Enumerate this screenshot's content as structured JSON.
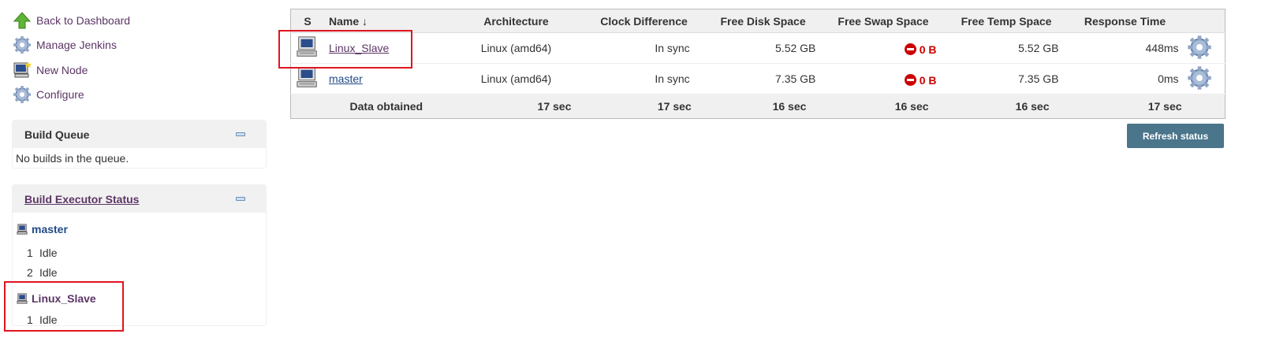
{
  "sidebar": {
    "tasks": [
      {
        "label": "Back to Dashboard",
        "icon": "up-arrow-icon"
      },
      {
        "label": "Manage Jenkins",
        "icon": "gear-icon"
      },
      {
        "label": "New Node",
        "icon": "new-computer-icon"
      },
      {
        "label": "Configure",
        "icon": "gear-icon"
      }
    ],
    "build_queue": {
      "title": "Build Queue",
      "empty_text": "No builds in the queue."
    },
    "executor_status": {
      "title": "Build Executor Status",
      "computers": [
        {
          "name": "master",
          "executors": [
            {
              "num": "1",
              "status": "Idle"
            },
            {
              "num": "2",
              "status": "Idle"
            }
          ]
        },
        {
          "name": "Linux_Slave",
          "executors": [
            {
              "num": "1",
              "status": "Idle"
            }
          ]
        }
      ]
    }
  },
  "table": {
    "headers": {
      "s": "S",
      "name": "Name ↓",
      "architecture": "Architecture",
      "clock": "Clock Difference",
      "disk": "Free Disk Space",
      "swap": "Free Swap Space",
      "temp": "Free Temp Space",
      "response": "Response Time"
    },
    "rows": [
      {
        "name": "Linux_Slave",
        "architecture": "Linux (amd64)",
        "clock": "In sync",
        "disk": "5.52 GB",
        "swap": "0 B",
        "temp": "5.52 GB",
        "response": "448ms"
      },
      {
        "name": "master",
        "architecture": "Linux (amd64)",
        "clock": "In sync",
        "disk": "7.35 GB",
        "swap": "0 B",
        "temp": "7.35 GB",
        "response": "0ms"
      }
    ],
    "footer": {
      "label": "Data obtained",
      "architecture": "17 sec",
      "clock": "17 sec",
      "disk": "16 sec",
      "swap": "16 sec",
      "temp": "16 sec",
      "response": "17 sec"
    }
  },
  "refresh_label": "Refresh status",
  "colors": {
    "highlight": "#e0141e",
    "visited_link": "#5c3566",
    "link": "#204a87",
    "warning": "#cc0000",
    "button": "#4b758b"
  }
}
